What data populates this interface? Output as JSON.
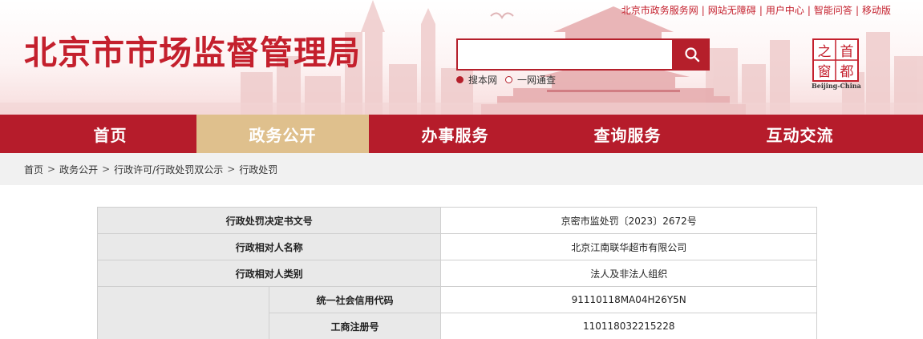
{
  "header": {
    "site_title": "北京市市场监督管理局",
    "top_links": [
      "北京市政务服务网",
      "网站无障碍",
      "用户中心",
      "智能问答",
      "移动版"
    ],
    "search": {
      "placeholder": "",
      "options": [
        "搜本网",
        "一网通查"
      ],
      "selected": 0
    },
    "logo": {
      "chars": [
        "首",
        "都",
        "之",
        "窗"
      ],
      "english": "Beijing-China"
    }
  },
  "nav": {
    "items": [
      "首页",
      "政务公开",
      "办事服务",
      "查询服务",
      "互动交流"
    ],
    "active": 1
  },
  "breadcrumb": [
    "首页",
    "政务公开",
    "行政许可/行政处罚双公示",
    "行政处罚"
  ],
  "table": {
    "rows": [
      {
        "label": "行政处罚决定书文号",
        "value": "京密市监处罚〔2023〕2672号"
      },
      {
        "label": "行政相对人名称",
        "value": "北京江南联华超市有限公司"
      },
      {
        "label": "行政相对人类别",
        "value": "法人及非法人组织"
      },
      {
        "label": "统一社会信用代码",
        "value": "91110118MA04H26Y5N"
      },
      {
        "label": "工商注册号",
        "value": "110118032215228"
      }
    ]
  },
  "colors": {
    "brand_red": "#b61c2b",
    "title_red": "#c4202d",
    "active_tab": "#dfc08d"
  },
  "icons": {
    "search": "search-icon",
    "logo": "capital-window-logo"
  }
}
